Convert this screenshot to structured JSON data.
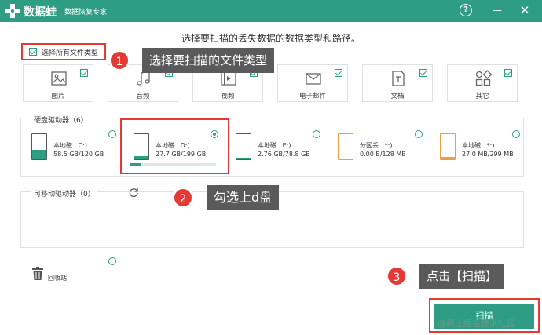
{
  "app": {
    "name": "数据蛙",
    "subtitle": "数据恢复专家"
  },
  "window_controls": {
    "help": "?",
    "minimize": "—",
    "close": "✕"
  },
  "heading": "选择要扫描的丢失数据的数据类型和路径。",
  "select_all": {
    "label": "选择所有文件类型",
    "checked": true
  },
  "file_types": [
    {
      "label": "图片",
      "icon": "image-icon",
      "checked": true
    },
    {
      "label": "音频",
      "icon": "music-icon",
      "checked": true
    },
    {
      "label": "视频",
      "icon": "video-icon",
      "checked": true
    },
    {
      "label": "电子邮件",
      "icon": "mail-icon",
      "checked": true
    },
    {
      "label": "文档",
      "icon": "document-icon",
      "checked": true
    },
    {
      "label": "其它",
      "icon": "other-icon",
      "checked": true
    }
  ],
  "hard_drives": {
    "title": "硬盘驱动器（6）",
    "items": [
      {
        "name": "本地磁...C:)",
        "size": "58.5 GB/120 GB",
        "selected": false,
        "used_fraction": 0.49,
        "color": "#2f9d84"
      },
      {
        "name": "本地磁...D:)",
        "size": "27.7 GB/199 GB",
        "selected": true,
        "used_fraction": 0.14,
        "color": "#2f9d84"
      },
      {
        "name": "本地磁...E:)",
        "size": "2.76 GB/78.8 GB",
        "selected": false,
        "used_fraction": 0.04,
        "color": "#2f9d84"
      },
      {
        "name": "分区丢...*:)",
        "size": "0.00  B/128 MB",
        "selected": false,
        "used_fraction": 0.0,
        "color": "#e8a33d"
      },
      {
        "name": "本地磁...*:)",
        "size": "27.0 MB/299 MB",
        "selected": false,
        "used_fraction": 0.09,
        "color": "#e8a33d"
      }
    ]
  },
  "removable": {
    "title": "可移动驱动器（0）"
  },
  "recycle": {
    "label": "回收站"
  },
  "scan_button": {
    "label": "扫描"
  },
  "callouts": [
    {
      "num": "1",
      "text": "选择要扫描的文件类型"
    },
    {
      "num": "2",
      "text": "勾选上d盘"
    },
    {
      "num": "3",
      "text": "点击【扫描】"
    }
  ],
  "watermark": "@稀土掘金技术社区",
  "colors": {
    "primary": "#2f9d84",
    "highlight": "#e53935",
    "callout_bg": "#5a5a5a",
    "warning": "#e8a33d"
  }
}
